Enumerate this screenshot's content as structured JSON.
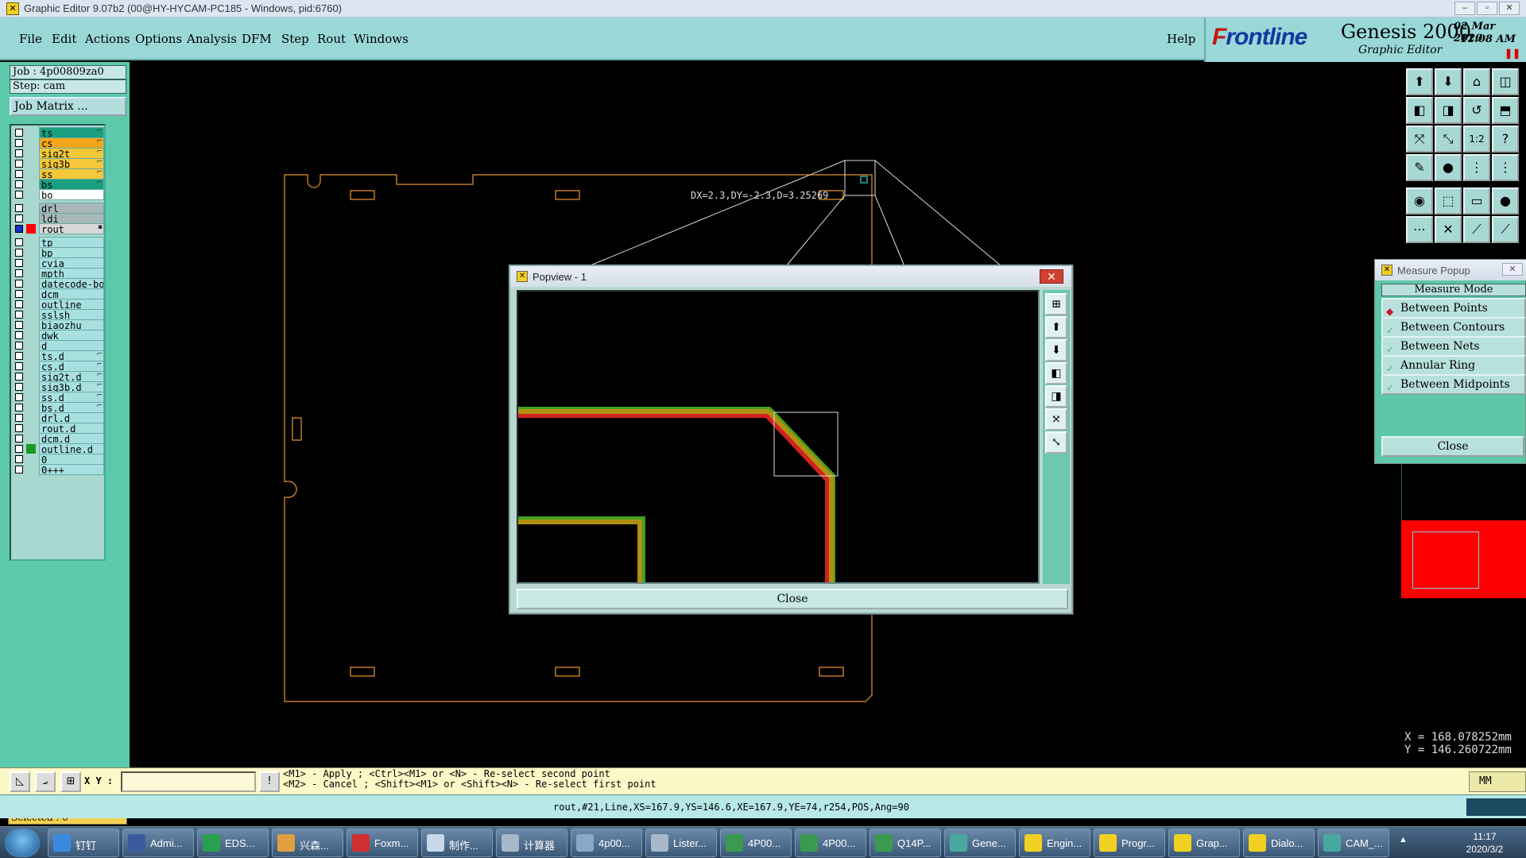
{
  "window": {
    "title": "Graphic Editor 9.07b2 (00@HY-HYCAM-PC185 - Windows, pid:6760)",
    "minimize": "‒",
    "maximize": "▫",
    "close": "✕"
  },
  "menu": {
    "file": "File",
    "edit": "Edit",
    "actions": "Actions",
    "options": "Options",
    "analysis": "Analysis",
    "dfm": "DFM",
    "step": "Step",
    "rout": "Rout",
    "windows": "Windows",
    "help": "Help"
  },
  "brand": {
    "logo_f": "F",
    "logo_rest": "rontline",
    "product": "Genesis 2000",
    "subtitle": "Graphic Editor",
    "date": "02 Mar 2020",
    "time": "11:08 AM"
  },
  "left_panel": {
    "job": "Job : 4p00809za0",
    "step": "Step: cam",
    "job_matrix": "Job Matrix ...",
    "selected": "Selected : 0"
  },
  "layers": [
    {
      "name": "ts",
      "color": "#1aa080",
      "mark": "⌐",
      "swatch": ""
    },
    {
      "name": "cs",
      "color": "#f4a818",
      "mark": "⌐",
      "swatch": ""
    },
    {
      "name": "sig2t",
      "color": "#f4c838",
      "mark": "⌐",
      "swatch": ""
    },
    {
      "name": "sig3b",
      "color": "#f4c838",
      "mark": "⌐",
      "swatch": ""
    },
    {
      "name": "ss",
      "color": "#f4c838",
      "mark": "⌐",
      "swatch": ""
    },
    {
      "name": "bs",
      "color": "#1aa080",
      "mark": "⌐",
      "swatch": ""
    },
    {
      "name": "bo",
      "color": "#ffffff",
      "mark": "",
      "swatch": ""
    },
    {
      "name": "drl",
      "color": "#a8b8b8",
      "mark": "",
      "swatch": ""
    },
    {
      "name": "ldi",
      "color": "#a8b8b8",
      "mark": "",
      "swatch": ""
    },
    {
      "name": "rout",
      "color": "#d8d8d8",
      "mark": "▪",
      "swatch": "#ff0000",
      "on": true
    },
    {
      "name": "tp",
      "color": "#a8e0e0",
      "mark": "",
      "swatch": ""
    },
    {
      "name": "bp",
      "color": "#a8e0e0",
      "mark": "",
      "swatch": ""
    },
    {
      "name": "cvia",
      "color": "#a8e0e0",
      "mark": "",
      "swatch": ""
    },
    {
      "name": "mpth",
      "color": "#a8e0e0",
      "mark": "",
      "swatch": ""
    },
    {
      "name": "datecode-bo",
      "color": "#a8e0e0",
      "mark": "",
      "swatch": ""
    },
    {
      "name": "dcm",
      "color": "#a8e0e0",
      "mark": "",
      "swatch": ""
    },
    {
      "name": "outline",
      "color": "#a8e0e0",
      "mark": "",
      "swatch": ""
    },
    {
      "name": "sslsh",
      "color": "#a8e0e0",
      "mark": "",
      "swatch": ""
    },
    {
      "name": "biaozhu",
      "color": "#a8e0e0",
      "mark": "",
      "swatch": ""
    },
    {
      "name": "dwk",
      "color": "#a8e0e0",
      "mark": "",
      "swatch": ""
    },
    {
      "name": "d",
      "color": "#a8e0e0",
      "mark": "",
      "swatch": ""
    },
    {
      "name": "ts.d",
      "color": "#a8e0e0",
      "mark": "⌐",
      "swatch": ""
    },
    {
      "name": "cs.d",
      "color": "#a8e0e0",
      "mark": "⌐",
      "swatch": ""
    },
    {
      "name": "sig2t.d",
      "color": "#a8e0e0",
      "mark": "⌐",
      "swatch": ""
    },
    {
      "name": "sig3b.d",
      "color": "#a8e0e0",
      "mark": "⌐",
      "swatch": ""
    },
    {
      "name": "ss.d",
      "color": "#a8e0e0",
      "mark": "⌐",
      "swatch": ""
    },
    {
      "name": "bs.d",
      "color": "#a8e0e0",
      "mark": "⌐",
      "swatch": ""
    },
    {
      "name": "drl.d",
      "color": "#a8e0e0",
      "mark": "",
      "swatch": ""
    },
    {
      "name": "rout.d",
      "color": "#a8e0e0",
      "mark": "",
      "swatch": ""
    },
    {
      "name": "dcm.d",
      "color": "#a8e0e0",
      "mark": "",
      "swatch": ""
    },
    {
      "name": "outline.d",
      "color": "#a8e0e0",
      "mark": "",
      "swatch": "#1a9a20"
    },
    {
      "name": "0",
      "color": "#a8e0e0",
      "mark": "",
      "swatch": ""
    },
    {
      "name": "0+++",
      "color": "#a8e0e0",
      "mark": "",
      "swatch": ""
    }
  ],
  "canvas": {
    "measure_text": "DX=2.3,DY=-2.3,D=3.25269"
  },
  "popview": {
    "title": "Popview - 1",
    "close_x": "✕",
    "close": "Close",
    "tools": [
      "⊞",
      "⬆",
      "⬇",
      "◧",
      "◨",
      "⤧",
      "⤡"
    ]
  },
  "right_tools": [
    "⬆",
    "⬇",
    "⌂",
    "◫",
    "◧",
    "◨",
    "↺",
    "⬒",
    "⤧",
    "⤡",
    "1:2",
    "?",
    "✎",
    "●",
    "⋮",
    "⋮",
    "◉",
    "⬚",
    "▭",
    "●",
    "⋯",
    "✕",
    "⟋",
    "⟋"
  ],
  "measure": {
    "title": "Measure Popup",
    "close_x": "✕",
    "mode": "Measure Mode",
    "options": [
      "Between Points",
      "Between Contours",
      "Between Nets",
      "Annular Ring",
      "Between Midpoints"
    ],
    "selected_index": 0,
    "close": "Close"
  },
  "coords": {
    "x": "X = 168.078252mm",
    "y": "Y = 146.260722mm"
  },
  "cmd": {
    "xy_label": "X Y :",
    "xy_value": "",
    "warn": "!",
    "hint_line1": "<M1> - Apply  ; <Ctrl><M1> or <N> - Re-select second point",
    "hint_line2": "<M2> - Cancel ; <Shift><M1> or <Shift><N> - Re-select first point",
    "units": "MM"
  },
  "status": {
    "text": "rout,#21,Line,XS=167.9,YS=146.6,XE=167.9,YE=74,r254,POS,Ang=90"
  },
  "taskbar": {
    "items": [
      {
        "label": "钉钉",
        "color": "#3a8ae0"
      },
      {
        "label": "Admi...",
        "color": "#3a5aa0"
      },
      {
        "label": "EDS...",
        "color": "#28a050"
      },
      {
        "label": "兴森...",
        "color": "#e0a040"
      },
      {
        "label": "Foxm...",
        "color": "#d03030"
      },
      {
        "label": "制作...",
        "color": "#c8d8e8"
      },
      {
        "label": "计算器",
        "color": "#a8b8c8"
      },
      {
        "label": "4p00...",
        "color": "#88a8c8"
      },
      {
        "label": "Lister...",
        "color": "#a8b8c8"
      },
      {
        "label": "4P00...",
        "color": "#3a9a50"
      },
      {
        "label": "4P00...",
        "color": "#3a9a50"
      },
      {
        "label": "Q14P...",
        "color": "#3a9a50"
      },
      {
        "label": "Gene...",
        "color": "#48a8a0"
      },
      {
        "label": "Engin...",
        "color": "#f0d020"
      },
      {
        "label": "Progr...",
        "color": "#f0d020"
      },
      {
        "label": "Grap...",
        "color": "#f0d020"
      },
      {
        "label": "Dialo...",
        "color": "#f0d020"
      },
      {
        "label": "CAM_...",
        "color": "#48a8a0"
      }
    ],
    "time": "11:17",
    "date": "2020/3/2",
    "tray_up": "▲"
  }
}
